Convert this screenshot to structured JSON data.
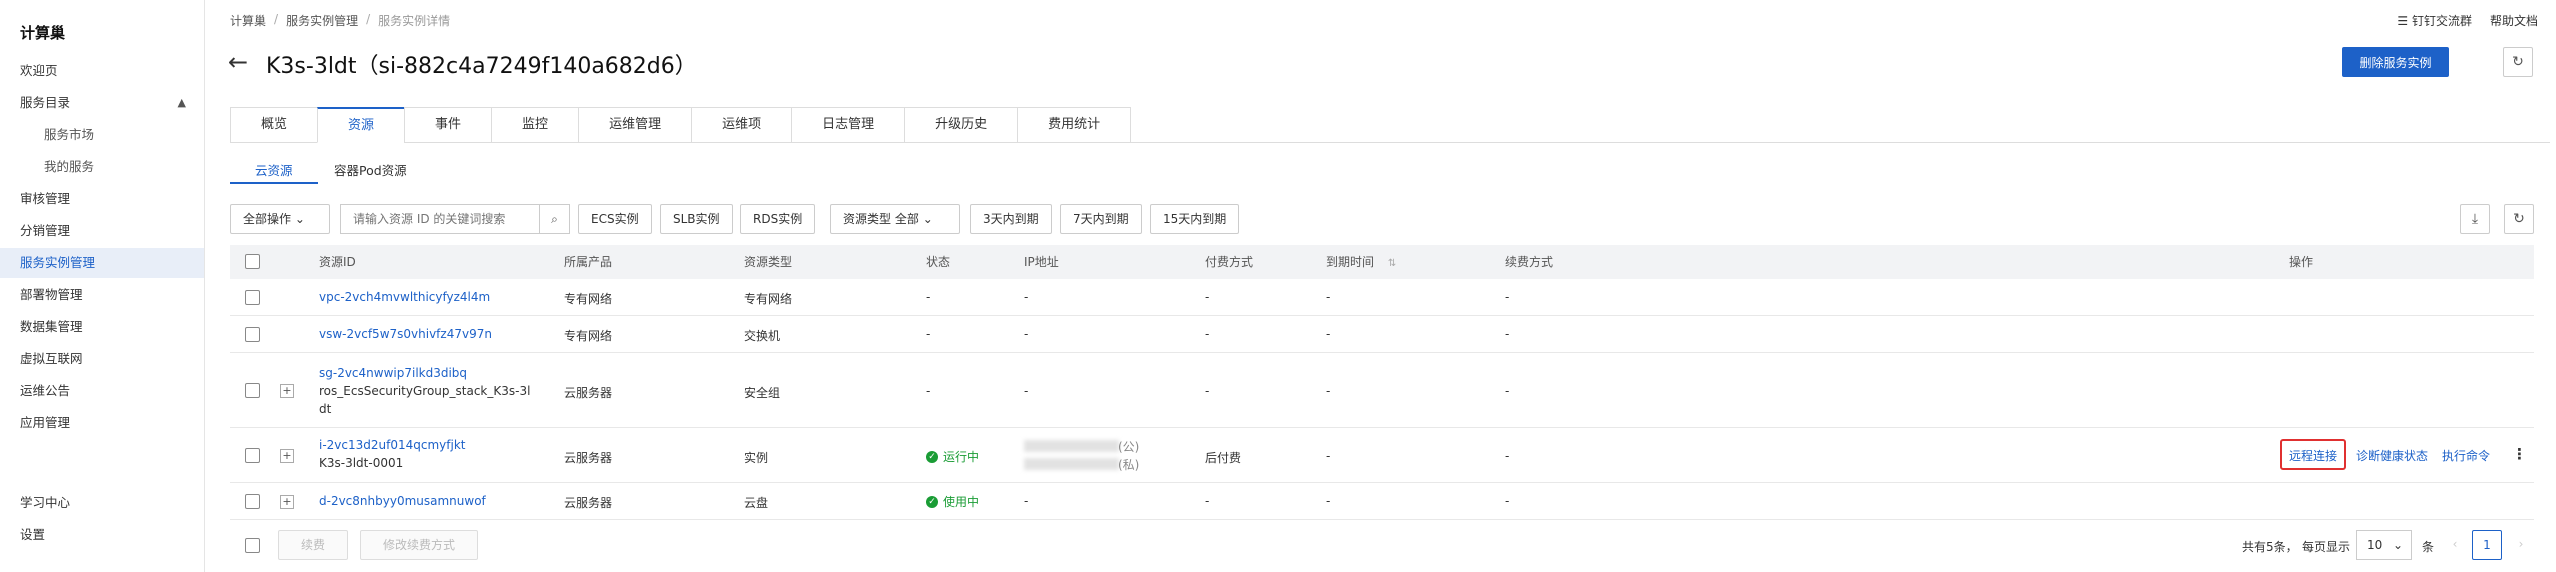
{
  "sidebar": {
    "brand": "计算巢",
    "items": [
      {
        "label": "欢迎页"
      },
      {
        "label": "服务目录"
      },
      {
        "label": "服务市场"
      },
      {
        "label": "我的服务"
      },
      {
        "label": "审核管理"
      },
      {
        "label": "分销管理"
      },
      {
        "label": "服务实例管理"
      },
      {
        "label": "部署物管理"
      },
      {
        "label": "数据集管理"
      },
      {
        "label": "虚拟互联网"
      },
      {
        "label": "运维公告"
      },
      {
        "label": "应用管理"
      },
      {
        "label": "学习中心"
      },
      {
        "label": "设置"
      }
    ]
  },
  "breadcrumb": [
    "计算巢",
    "服务实例管理",
    "服务实例详情"
  ],
  "top_links": [
    "钉钉交流群",
    "帮助文档"
  ],
  "page_title": "K3s-3ldt（si-882c4a7249f140a682d6）",
  "actions": {
    "delete": "删除服务实例"
  },
  "tabs": [
    "概览",
    "资源",
    "事件",
    "监控",
    "运维管理",
    "运维项",
    "日志管理",
    "升级历史",
    "费用统计"
  ],
  "subtabs": [
    "云资源",
    "容器Pod资源"
  ],
  "toolbar": {
    "all_ops": "全部操作",
    "search_placeholder": "请输入资源 ID 的关键词搜索",
    "type_filters": [
      "ECS实例",
      "SLB实例",
      "RDS实例"
    ],
    "resource_type_label": "资源类型",
    "resource_type_value": "全部",
    "expiry_filters": [
      "3天内到期",
      "7天内到期",
      "15天内到期"
    ]
  },
  "table": {
    "headers": [
      "资源ID",
      "所属产品",
      "资源类型",
      "状态",
      "IP地址",
      "付费方式",
      "到期时间",
      "续费方式",
      "操作"
    ],
    "rows": [
      {
        "id": "vpc-2vch4mvwlthicyfyz4l4m",
        "product": "专有网络",
        "type": "专有网络",
        "status": "-",
        "ip": "-",
        "pay": "-",
        "expire": "-",
        "renew": "-"
      },
      {
        "id": "vsw-2vcf5w7s0vhivfz47v97n",
        "product": "专有网络",
        "type": "交换机",
        "status": "-",
        "ip": "-",
        "pay": "-",
        "expire": "-",
        "renew": "-"
      },
      {
        "id": "sg-2vc4nwwip7ilkd3dibq",
        "name1": "ros_EcsSecurityGroup_stack_K3s-3l",
        "name2": "dt",
        "product": "云服务器",
        "type": "安全组",
        "status": "-",
        "ip": "-",
        "pay": "-",
        "expire": "-",
        "renew": "-"
      },
      {
        "id": "i-2vc13d2uf014qcmyfjkt",
        "name1": "K3s-3ldt-0001",
        "product": "云服务器",
        "type": "实例",
        "status": "运行中",
        "ip_pub_tag": "(公)",
        "ip_priv_tag": "(私)",
        "pay": "后付费",
        "expire": "-",
        "renew": "-",
        "ops": [
          "远程连接",
          "诊断健康状态",
          "执行命令"
        ]
      },
      {
        "id": "d-2vc8nhbyy0musamnuwof",
        "product": "云服务器",
        "type": "云盘",
        "status": "使用中",
        "ip": "-",
        "pay": "-",
        "expire": "-",
        "renew": "-"
      }
    ]
  },
  "footer": {
    "renew": "续费",
    "modify_renew": "修改续费方式",
    "total": "共有5条，",
    "per_page": "每页显示",
    "page_size": "10",
    "unit": "条",
    "current_page": "1"
  },
  "colors": {
    "accent": "#1d61c8",
    "success": "#1a9c35",
    "highlight": "#e03030"
  }
}
